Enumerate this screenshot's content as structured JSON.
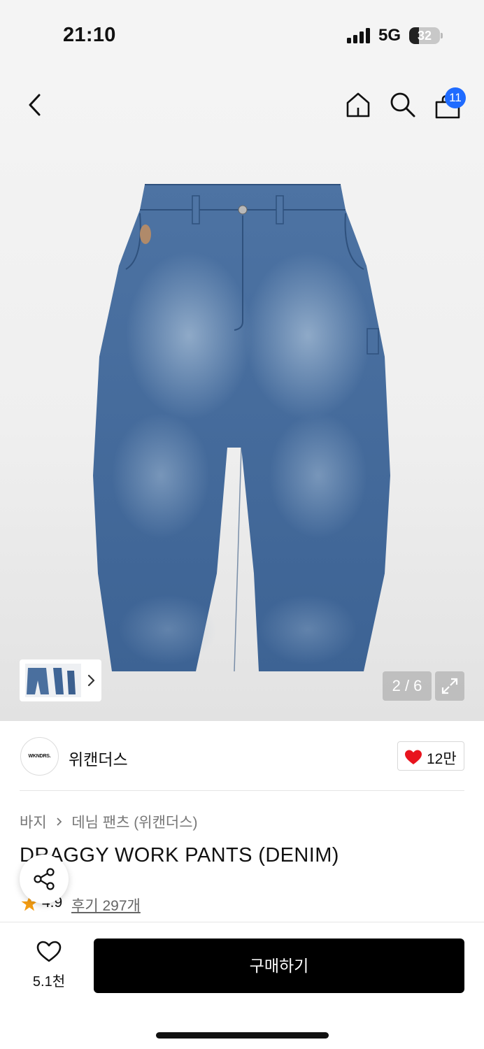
{
  "status_bar": {
    "time": "21:10",
    "network": "5G",
    "battery_level": "32",
    "battery_fraction": 0.32
  },
  "nav": {
    "back_icon": "chevron-left-icon",
    "home_icon": "home-icon",
    "search_icon": "search-icon",
    "cart_icon": "shopping-bag-icon",
    "cart_badge": "11"
  },
  "gallery": {
    "counter": "2 / 6",
    "expand_icon": "expand-icon",
    "thumbnail_icon": "chevron-right-icon"
  },
  "brand": {
    "logo_text": "WKNDRS.",
    "name": "위캔더스",
    "like_count": "12만"
  },
  "breadcrumb": {
    "category": "바지",
    "subcategory": "데님 팬츠 (위캔더스)"
  },
  "product": {
    "title": "DRAGGY WORK PANTS (DENIM)",
    "rating": "4.9",
    "reviews": "후기 297개"
  },
  "bottom_bar": {
    "wish_count": "5.1천",
    "buy_label": "구매하기"
  },
  "colors": {
    "accent_blue": "#1f6bff",
    "heart_red": "#e8141e",
    "star_orange": "#f39c12",
    "buy_black": "#000000"
  }
}
